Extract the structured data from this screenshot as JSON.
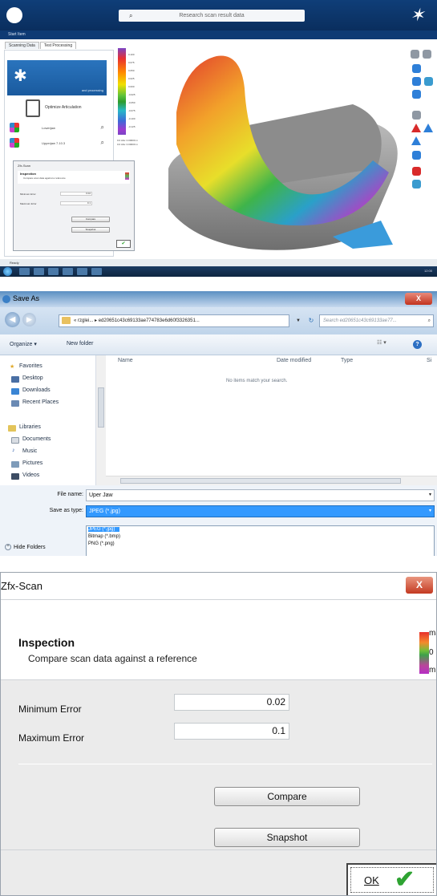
{
  "scan_app": {
    "search_placeholder": "Research scan result data",
    "menu_label": "Start Item",
    "tabs": [
      {
        "label": "Scanning Data"
      },
      {
        "label": "Test Processing"
      }
    ],
    "hero_caption": "and processing",
    "optimize_label": "Optimize Articulation",
    "list_items": [
      {
        "label": "Lowerjaw"
      },
      {
        "label": "Upperjaw 7.10.3"
      }
    ],
    "mini_dialog": {
      "title": "Zfx-Scan",
      "heading": "Inspection",
      "subheading": "Compare scan data against a reference",
      "min_label": "Minimum Error",
      "min_value": "0.02",
      "max_label": "Maximum Error",
      "max_value": "0.1",
      "compare_label": "Compare",
      "snapshot_label": "Snapshot",
      "ok_mark": "✔"
    },
    "legend_ticks": [
      "0.100",
      "0.075",
      "0.050",
      "0.025",
      "0.000",
      "-0.025",
      "-0.050",
      "-0.075",
      "-0.100",
      "-0.125"
    ],
    "stats_line1": "0.0 Abs: 0.00000 m",
    "stats_line2": "0.0 Abs: 0.00000 m",
    "status_text": "Ready",
    "clock": "12:00",
    "colors": {
      "title_bar": "#0f3e78",
      "accent": "#2e7fd8"
    }
  },
  "save_as": {
    "title": "Save As",
    "close_label": "X",
    "address": "« rzglei... ▸ ed20651c43c69133ae774783e6d60f3326351...",
    "search_placeholder": "Search ed20651c43c69133ae77...",
    "organize_label": "Organize ▾",
    "new_folder_label": "New folder",
    "sidebar": {
      "favorites": "Favorites",
      "desktop": "Desktop",
      "downloads": "Downloads",
      "recent": "Recent Places",
      "libraries": "Libraries",
      "documents": "Documents",
      "music": "Music",
      "pictures": "Pictures",
      "videos": "Videos"
    },
    "columns": {
      "name": "Name",
      "date": "Date modified",
      "type": "Type",
      "size": "Si"
    },
    "empty_message": "No items match your search.",
    "file_name_label": "File name:",
    "file_name_value": "Uper Jaw",
    "save_type_label": "Save as type:",
    "save_type_value": "JPEG (*.jpg)",
    "type_options": [
      "JPEG (*.jpg)",
      "Bitmap (*.bmp)",
      "PNG (*.png)"
    ],
    "hide_folders_label": "Hide Folders"
  },
  "zfx_dialog": {
    "title": "Zfx-Scan",
    "close_label": "X",
    "heading": "Inspection",
    "subheading": "Compare scan data against a reference",
    "scale_max": "ma",
    "scale_zero": "0",
    "scale_min": "mi",
    "min_error_label": "Minimum Error",
    "min_error_value": "0.02",
    "max_error_label": "Maximum Error",
    "max_error_value": "0.1",
    "compare_label": "Compare",
    "snapshot_label": "Snapshot",
    "ok_label": "OK",
    "ok_check": "✔"
  }
}
